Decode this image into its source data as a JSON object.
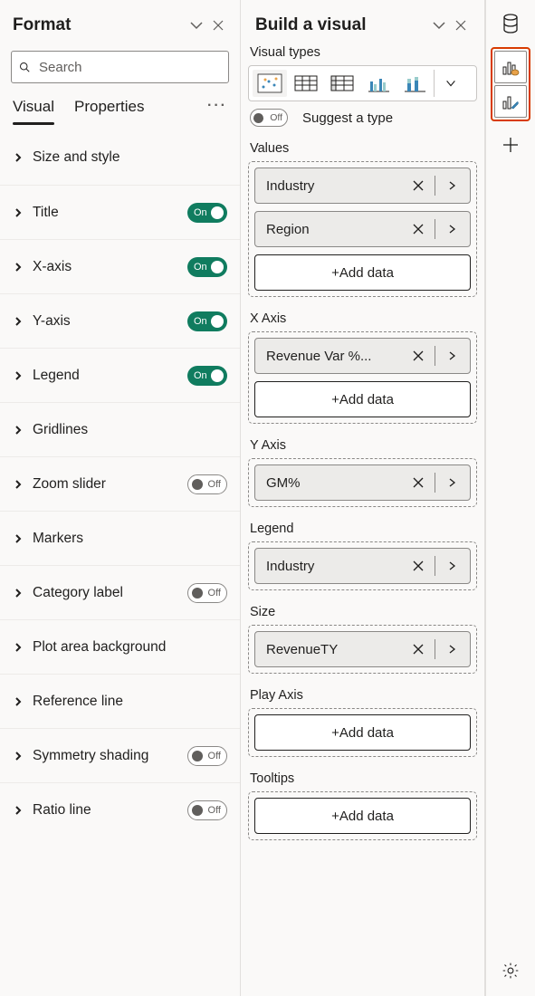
{
  "format": {
    "title": "Format",
    "search_placeholder": "Search",
    "tabs": {
      "visual": "Visual",
      "properties": "Properties",
      "more": "···"
    },
    "cards": [
      {
        "label": "Size and style",
        "toggle": null
      },
      {
        "label": "Title",
        "toggle": "On"
      },
      {
        "label": "X-axis",
        "toggle": "On"
      },
      {
        "label": "Y-axis",
        "toggle": "On"
      },
      {
        "label": "Legend",
        "toggle": "On"
      },
      {
        "label": "Gridlines",
        "toggle": null
      },
      {
        "label": "Zoom slider",
        "toggle": "Off"
      },
      {
        "label": "Markers",
        "toggle": null
      },
      {
        "label": "Category label",
        "toggle": "Off"
      },
      {
        "label": "Plot area background",
        "toggle": null
      },
      {
        "label": "Reference line",
        "toggle": null
      },
      {
        "label": "Symmetry shading",
        "toggle": "Off"
      },
      {
        "label": "Ratio line",
        "toggle": "Off"
      }
    ]
  },
  "build": {
    "title": "Build a visual",
    "visual_types_label": "Visual types",
    "suggest": {
      "toggle_text": "Off",
      "label": "Suggest a type"
    },
    "wells": {
      "values": {
        "label": "Values",
        "fields": [
          "Industry",
          "Region"
        ],
        "add": "+Add data"
      },
      "xaxis": {
        "label": "X Axis",
        "fields": [
          "Revenue Var %..."
        ],
        "add": "+Add data"
      },
      "yaxis": {
        "label": "Y Axis",
        "fields": [
          "GM%"
        ]
      },
      "legend": {
        "label": "Legend",
        "fields": [
          "Industry"
        ]
      },
      "size": {
        "label": "Size",
        "fields": [
          "RevenueTY"
        ]
      },
      "playaxis": {
        "label": "Play Axis",
        "fields": [],
        "add": "+Add data"
      },
      "tooltips": {
        "label": "Tooltips",
        "fields": [],
        "add": "+Add data"
      }
    }
  },
  "rail": {
    "data_icon": "data",
    "build_icon": "build-visual",
    "format_icon": "paint"
  }
}
